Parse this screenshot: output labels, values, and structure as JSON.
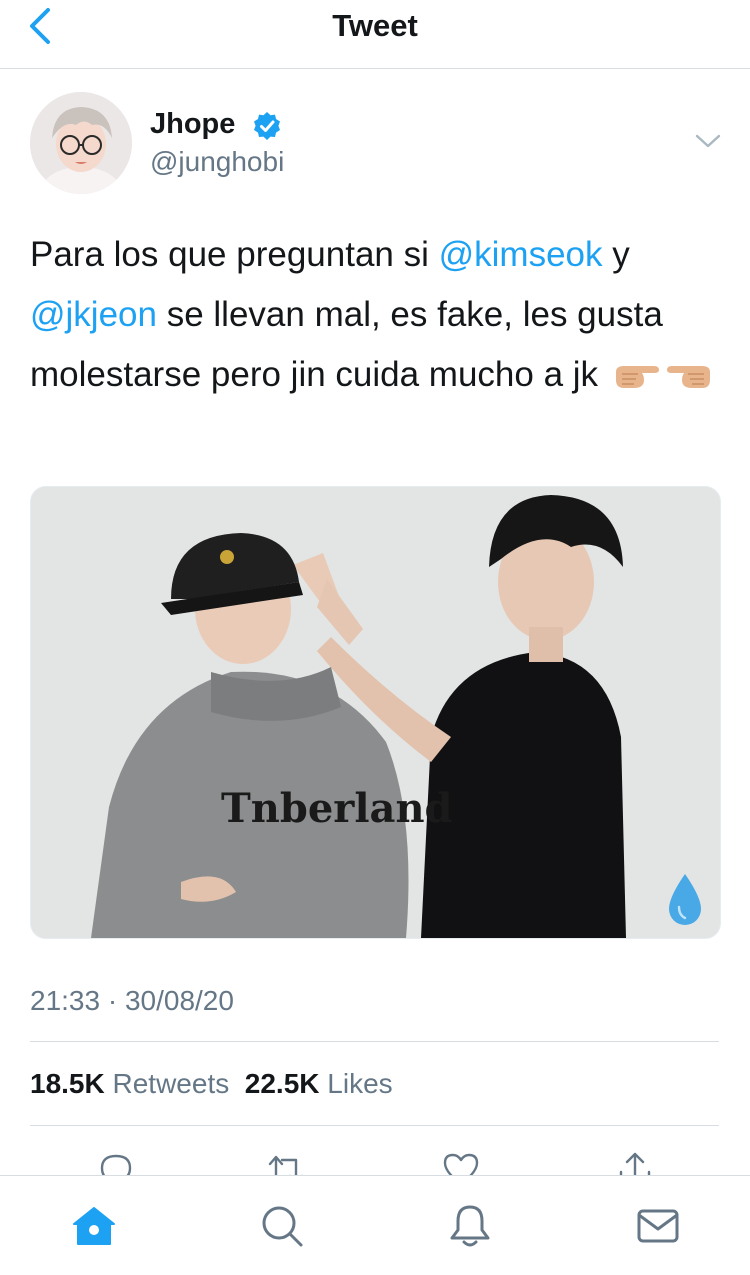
{
  "header": {
    "title": "Tweet",
    "back_icon": "chevron-left-icon"
  },
  "author": {
    "name": "Jhope",
    "handle": "@junghobi",
    "verified": true,
    "verified_icon": "verified-badge-icon",
    "menu_icon": "chevron-down-icon"
  },
  "tweet": {
    "text_before_mention1": "Para los que preguntan si ",
    "mention1": "@kimseok",
    "text_after_mention1": " y",
    "mention2": "@jkjeon",
    "text_after_mention2": " se llevan mal, es fake, les gusta molestarse pero jin cuida mucho a jk",
    "emoji": "👉🏼👈🏼",
    "media_badge_icon": "water-drop-icon",
    "media_print_text": "Tnberland",
    "timestamp": "21:33 · 30/08/20"
  },
  "stats": {
    "retweets_count": "18.5K",
    "retweets_label": "Retweets",
    "likes_count": "22.5K",
    "likes_label": "Likes"
  },
  "actions": [
    "reply-icon",
    "retweet-icon",
    "like-icon",
    "share-icon"
  ],
  "tabbar": {
    "items": [
      "home-icon",
      "search-icon",
      "notifications-icon",
      "messages-icon"
    ],
    "active": "home-icon"
  },
  "colors": {
    "accent": "#1da1f2",
    "secondary_text": "#657786",
    "primary_text": "#14171a",
    "divider": "#d8dde1"
  }
}
